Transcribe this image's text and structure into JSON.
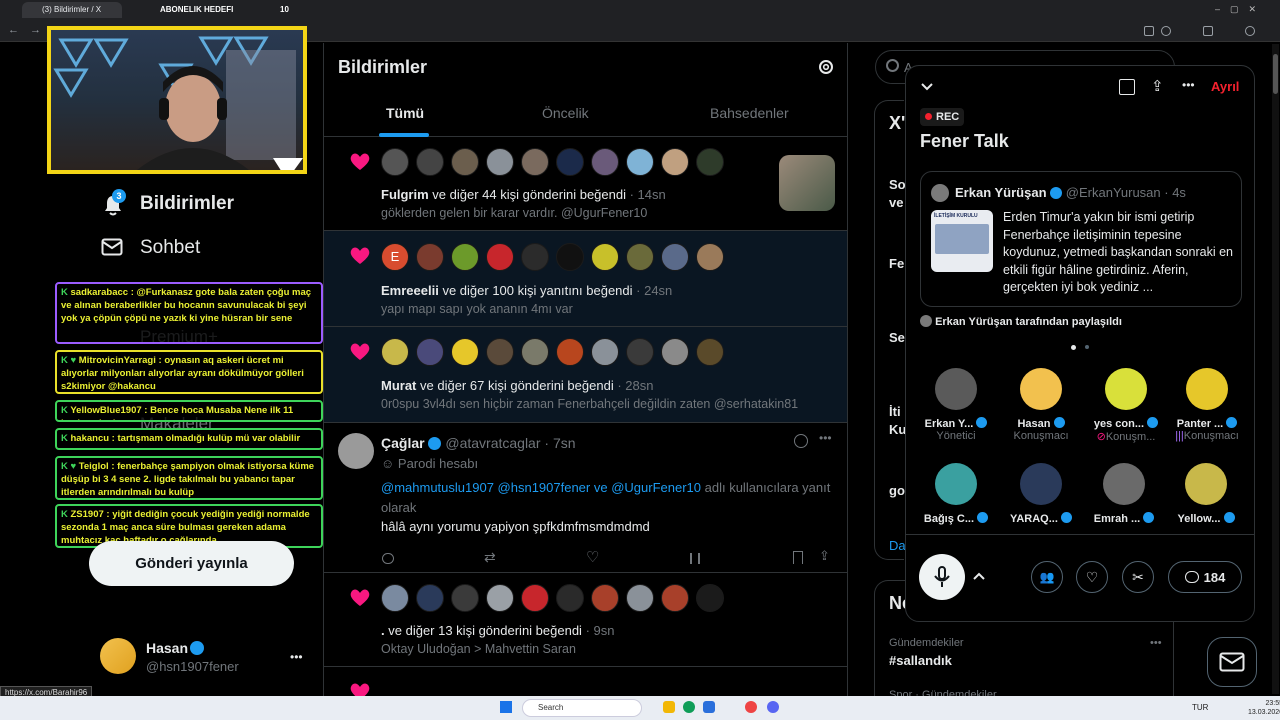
{
  "browser": {
    "tab1": "(3) Bildirimler / X",
    "tab2": "ABONELIK HEDEFI",
    "tab3": "10",
    "status_url": "https://x.com/Barahir96"
  },
  "nav": {
    "notifications_label": "Bildirimler",
    "notifications_badge": "3",
    "chat_label": "Sohbet",
    "premium_label": "Premium+",
    "articles_label": "Makaleler",
    "post_button": "Gönderi yayınla",
    "profile_name": "Hasan",
    "profile_handle": "@hsn1907fener",
    "more": "•••"
  },
  "chat_overlay": [
    {
      "user": "sadkarabacc",
      "text": "@Furkanasz gote bala zaten çoğu maç ve alınan beraberlikler bu hocanın savunulacak bi şeyi yok ya çöpün çöpü ne yazık ki yine hüsran bir sene"
    },
    {
      "user": "MitrovicinYarragi",
      "text": "oynasın aq askeri ücret mi alıyorlar milyonları alıyorlar ayranı dökülmüyor gölleri s2kimiyor @hakancu"
    },
    {
      "user": "YellowBlue1907",
      "text": "Bence hoca Musaba Nene ilk 11 başlamalıydı"
    },
    {
      "user": "hakancu",
      "text": "tartışmam olmadığı kulüp mü var olabilir"
    },
    {
      "user": "Teiglol",
      "text": "fenerbahçe şampiyon olmak istiyorsa küme düşüp bi 3 4 sene 2. ligde takılmalı bu yabancı tapar itlerden arındırılmalı bu kulüp"
    },
    {
      "user": "ZS1907",
      "text": "yiğit dediğin çocuk yediğin yediği normalde sezonda 1 maç anca süre bulması gereken adama muhtacız kaç haftadır o çağlarında ..."
    }
  ],
  "header": {
    "title": "Bildirimler",
    "tabs": [
      "Tümü",
      "Öncelik",
      "Bahsedenler"
    ],
    "active_tab": 0
  },
  "notifications": [
    {
      "actor": "Fulgrim",
      "text": "ve diğer 44 kişi gönderini beğendi",
      "time": "· 14sn",
      "sub": "göklerden gelen bir karar vardır. @UgurFener10"
    },
    {
      "actor": "Emreeelii",
      "text": "ve diğer 100 kişi yanıtını beğendi",
      "time": "· 24sn",
      "sub": "yapı mapı sapı yok ananın 4mı var"
    },
    {
      "actor": "Murat",
      "text": "ve diğer 67 kişi gönderini beğendi",
      "time": "· 28sn",
      "sub": "0r0spu 3vl4dı sen hiçbir zaman Fenerbahçeli değildin zaten @serhatakin81"
    },
    {
      "actor": ".",
      "text": "ve diğer 13 kişi gönderini beğendi",
      "time": "· 9sn",
      "sub": "Oktay Uludoğan > Mahvettin Saran"
    }
  ],
  "reply": {
    "name": "Çağlar",
    "handle": "@atavratcaglar",
    "time": "· 7sn",
    "parody": "Parodi hesabı",
    "mentions": "@mahmutuslu1907 @hsn1907fener ve @UgurFener10",
    "mention_suffix": "adlı kullanıcılara yanıt olarak",
    "body": "hâlâ aynı yorumu yapiyon şpfkdmfmsmdmdmd"
  },
  "space": {
    "rec": "REC",
    "title": "Fener Talk",
    "leave": "Ayrıl",
    "tweet_author": "Erkan Yürüşan",
    "tweet_handle": "@ErkanYurusan",
    "tweet_time": "· 4s",
    "tweet_text": "Erden Timur'a yakın bir ismi getirip Fenerbahçe iletişiminin tepesine koydunuz, yetmedi başkandan sonraki en etkili figür hâline getirdiniz. Aferin, gerçekten iyi bok yediniz ...",
    "tweet_thumb_label": "İLETİŞİM KURULU",
    "shared_by": "Erkan Yürüşan tarafından paylaşıldı",
    "participants": [
      {
        "name": "Erkan Y...",
        "role": "Yönetici"
      },
      {
        "name": "Hasan",
        "role": "Konuşmacı"
      },
      {
        "name": "yes con...",
        "role": "Konuşm..."
      },
      {
        "name": "Panter ...",
        "role": "Konuşmacı"
      },
      {
        "name": "Bağış C...",
        "role": ""
      },
      {
        "name": "YARAQ...",
        "role": ""
      },
      {
        "name": "Emrah ...",
        "role": ""
      },
      {
        "name": "Yellow...",
        "role": ""
      }
    ],
    "comment_count": "184"
  },
  "right_col": {
    "search_placeholder": "A",
    "trend1_head": "X'",
    "side_words": [
      "So",
      "ve",
      "Fe",
      "Se",
      "İti",
      "Ku",
      "go",
      "Da"
    ],
    "news_head": "Ne",
    "trend_category": "Gündemdekiler",
    "trend_name": "#sallandık",
    "trend_next": "Spor · Gündemdekiler"
  },
  "taskbar": {
    "search": "Search",
    "lang": "TUR",
    "time": "23:55",
    "date": "13.03.2026"
  },
  "colors": {
    "accent": "#1d9bf0",
    "heart": "#f91880",
    "chat_yellow": "#eaf033",
    "rec": "#f4212e"
  }
}
